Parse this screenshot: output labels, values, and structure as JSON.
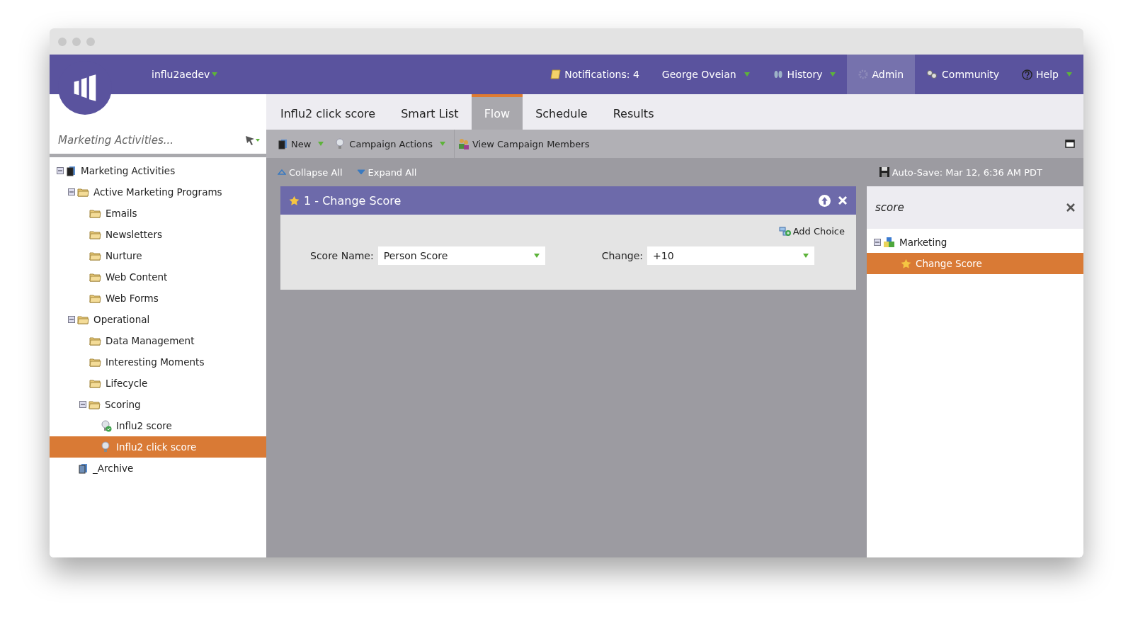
{
  "header": {
    "account": {
      "label": "influ2aedev",
      "dropdown": true
    },
    "nav": [
      {
        "label": "Notifications: 4",
        "dropdown": false,
        "selected": false
      },
      {
        "label": "George Oveian",
        "dropdown": true,
        "selected": false
      },
      {
        "label": "History",
        "dropdown": true,
        "selected": false
      },
      {
        "label": "Admin",
        "dropdown": false,
        "selected": true
      },
      {
        "label": "Community",
        "dropdown": false,
        "selected": false
      },
      {
        "label": "Help",
        "dropdown": true,
        "selected": false
      }
    ]
  },
  "sidebar": {
    "search": {
      "placeholder": "Marketing Activities..."
    },
    "tree": [
      {
        "label": "Marketing Activities",
        "kind": "root",
        "expanded": true,
        "selected": false,
        "children": [
          {
            "label": "Active Marketing Programs",
            "kind": "folder",
            "expanded": true,
            "selected": false,
            "children": [
              {
                "label": "Emails",
                "kind": "folder",
                "selected": false
              },
              {
                "label": "Newsletters",
                "kind": "folder",
                "selected": false
              },
              {
                "label": "Nurture",
                "kind": "folder",
                "selected": false
              },
              {
                "label": "Web Content",
                "kind": "folder",
                "selected": false
              },
              {
                "label": "Web Forms",
                "kind": "folder",
                "selected": false
              }
            ]
          },
          {
            "label": "Operational",
            "kind": "folder",
            "expanded": true,
            "selected": false,
            "children": [
              {
                "label": "Data Management",
                "kind": "folder",
                "selected": false
              },
              {
                "label": "Interesting Moments",
                "kind": "folder",
                "selected": false
              },
              {
                "label": "Lifecycle",
                "kind": "folder",
                "selected": false
              },
              {
                "label": "Scoring",
                "kind": "folder",
                "expanded": true,
                "selected": false,
                "children": [
                  {
                    "label": "Influ2 score",
                    "kind": "active-campaign",
                    "selected": false
                  },
                  {
                    "label": "Influ2 click score",
                    "kind": "campaign",
                    "selected": true
                  }
                ]
              }
            ]
          },
          {
            "label": "_Archive",
            "kind": "archive",
            "selected": false
          }
        ]
      }
    ]
  },
  "tabs": [
    {
      "label": "Influ2 click score",
      "selected": false
    },
    {
      "label": "Smart List",
      "selected": false
    },
    {
      "label": "Flow",
      "selected": true
    },
    {
      "label": "Schedule",
      "selected": false
    },
    {
      "label": "Results",
      "selected": false
    }
  ],
  "toolbar": [
    {
      "label": "New",
      "dropdown": true
    },
    {
      "label": "Campaign Actions",
      "dropdown": true
    },
    {
      "label": "View Campaign Members",
      "dropdown": false
    }
  ],
  "flow_bar": {
    "collapse_all": "Collapse All",
    "expand_all": "Expand All",
    "autosave": "Auto-Save: Mar 12, 6:36 AM PDT"
  },
  "flow_step": {
    "title": "1 - Change Score",
    "add_choice": "Add Choice",
    "fields": [
      {
        "label": "Score Name:",
        "value": "Person Score"
      },
      {
        "label": "Change:",
        "value": "+10"
      }
    ]
  },
  "palette": {
    "search": {
      "value": "score"
    },
    "tree": [
      {
        "label": "Marketing",
        "kind": "group",
        "expanded": true,
        "selected": false,
        "children": [
          {
            "label": "Change Score",
            "kind": "flow-action",
            "selected": true
          }
        ]
      }
    ]
  }
}
